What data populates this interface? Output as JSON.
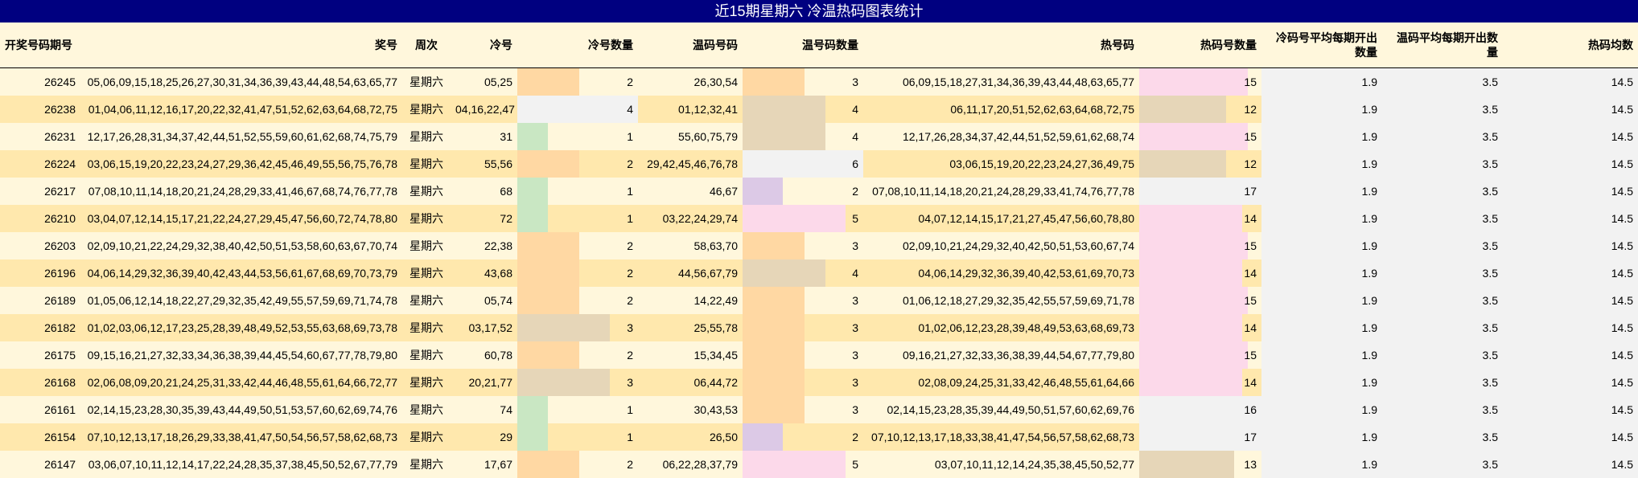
{
  "title": "近15期星期六 冷温热码图表统计",
  "headers": {
    "issue": "开奖号码期号",
    "numbers": "奖号",
    "weekday": "周次",
    "cold": "冷号",
    "cold_count": "冷号数量",
    "warm": "温码号码",
    "warm_count": "温号码数量",
    "hot": "热号码",
    "hot_count": "热码号数量",
    "cold_avg": "冷码号平均每期开出数量",
    "warm_avg": "温码平均每期开出数量",
    "hot_avg": "热码均数"
  },
  "colors": {
    "c1": "#c9e7c3",
    "c2": "#ffd8a3",
    "c3": "#e6d6b8",
    "c4": "#f2f2f2",
    "c5": "#fcd9ea",
    "c6": "#dcc9e6"
  },
  "rows": [
    {
      "issue": "26245",
      "numbers": "05,06,09,15,18,25,26,27,30,31,34,36,39,43,44,48,54,63,65,77",
      "weekday": "星期六",
      "cold": "05,25",
      "cold_count": 2,
      "warm": "26,30,54",
      "warm_count": 3,
      "hot": "06,09,15,18,27,31,34,36,39,43,44,48,63,65,77",
      "hot_count": 15,
      "cold_avg": "1.9",
      "warm_avg": "3.5",
      "hot_avg": "14.5"
    },
    {
      "issue": "26238",
      "numbers": "01,04,06,11,12,16,17,20,22,32,41,47,51,52,62,63,64,68,72,75",
      "weekday": "星期六",
      "cold": "04,16,22,47",
      "cold_count": 4,
      "warm": "01,12,32,41",
      "warm_count": 4,
      "hot": "06,11,17,20,51,52,62,63,64,68,72,75",
      "hot_count": 12,
      "cold_avg": "1.9",
      "warm_avg": "3.5",
      "hot_avg": "14.5"
    },
    {
      "issue": "26231",
      "numbers": "12,17,26,28,31,34,37,42,44,51,52,55,59,60,61,62,68,74,75,79",
      "weekday": "星期六",
      "cold": "31",
      "cold_count": 1,
      "warm": "55,60,75,79",
      "warm_count": 4,
      "hot": "12,17,26,28,34,37,42,44,51,52,59,61,62,68,74",
      "hot_count": 15,
      "cold_avg": "1.9",
      "warm_avg": "3.5",
      "hot_avg": "14.5"
    },
    {
      "issue": "26224",
      "numbers": "03,06,15,19,20,22,23,24,27,29,36,42,45,46,49,55,56,75,76,78",
      "weekday": "星期六",
      "cold": "55,56",
      "cold_count": 2,
      "warm": "29,42,45,46,76,78",
      "warm_count": 6,
      "hot": "03,06,15,19,20,22,23,24,27,36,49,75",
      "hot_count": 12,
      "cold_avg": "1.9",
      "warm_avg": "3.5",
      "hot_avg": "14.5"
    },
    {
      "issue": "26217",
      "numbers": "07,08,10,11,14,18,20,21,24,28,29,33,41,46,67,68,74,76,77,78",
      "weekday": "星期六",
      "cold": "68",
      "cold_count": 1,
      "warm": "46,67",
      "warm_count": 2,
      "hot": "07,08,10,11,14,18,20,21,24,28,29,33,41,74,76,77,78",
      "hot_count": 17,
      "cold_avg": "1.9",
      "warm_avg": "3.5",
      "hot_avg": "14.5"
    },
    {
      "issue": "26210",
      "numbers": "03,04,07,12,14,15,17,21,22,24,27,29,45,47,56,60,72,74,78,80",
      "weekday": "星期六",
      "cold": "72",
      "cold_count": 1,
      "warm": "03,22,24,29,74",
      "warm_count": 5,
      "hot": "04,07,12,14,15,17,21,27,45,47,56,60,78,80",
      "hot_count": 14,
      "cold_avg": "1.9",
      "warm_avg": "3.5",
      "hot_avg": "14.5"
    },
    {
      "issue": "26203",
      "numbers": "02,09,10,21,22,24,29,32,38,40,42,50,51,53,58,60,63,67,70,74",
      "weekday": "星期六",
      "cold": "22,38",
      "cold_count": 2,
      "warm": "58,63,70",
      "warm_count": 3,
      "hot": "02,09,10,21,24,29,32,40,42,50,51,53,60,67,74",
      "hot_count": 15,
      "cold_avg": "1.9",
      "warm_avg": "3.5",
      "hot_avg": "14.5"
    },
    {
      "issue": "26196",
      "numbers": "04,06,14,29,32,36,39,40,42,43,44,53,56,61,67,68,69,70,73,79",
      "weekday": "星期六",
      "cold": "43,68",
      "cold_count": 2,
      "warm": "44,56,67,79",
      "warm_count": 4,
      "hot": "04,06,14,29,32,36,39,40,42,53,61,69,70,73",
      "hot_count": 14,
      "cold_avg": "1.9",
      "warm_avg": "3.5",
      "hot_avg": "14.5"
    },
    {
      "issue": "26189",
      "numbers": "01,05,06,12,14,18,22,27,29,32,35,42,49,55,57,59,69,71,74,78",
      "weekday": "星期六",
      "cold": "05,74",
      "cold_count": 2,
      "warm": "14,22,49",
      "warm_count": 3,
      "hot": "01,06,12,18,27,29,32,35,42,55,57,59,69,71,78",
      "hot_count": 15,
      "cold_avg": "1.9",
      "warm_avg": "3.5",
      "hot_avg": "14.5"
    },
    {
      "issue": "26182",
      "numbers": "01,02,03,06,12,17,23,25,28,39,48,49,52,53,55,63,68,69,73,78",
      "weekday": "星期六",
      "cold": "03,17,52",
      "cold_count": 3,
      "warm": "25,55,78",
      "warm_count": 3,
      "hot": "01,02,06,12,23,28,39,48,49,53,63,68,69,73",
      "hot_count": 14,
      "cold_avg": "1.9",
      "warm_avg": "3.5",
      "hot_avg": "14.5"
    },
    {
      "issue": "26175",
      "numbers": "09,15,16,21,27,32,33,34,36,38,39,44,45,54,60,67,77,78,79,80",
      "weekday": "星期六",
      "cold": "60,78",
      "cold_count": 2,
      "warm": "15,34,45",
      "warm_count": 3,
      "hot": "09,16,21,27,32,33,36,38,39,44,54,67,77,79,80",
      "hot_count": 15,
      "cold_avg": "1.9",
      "warm_avg": "3.5",
      "hot_avg": "14.5"
    },
    {
      "issue": "26168",
      "numbers": "02,06,08,09,20,21,24,25,31,33,42,44,46,48,55,61,64,66,72,77",
      "weekday": "星期六",
      "cold": "20,21,77",
      "cold_count": 3,
      "warm": "06,44,72",
      "warm_count": 3,
      "hot": "02,08,09,24,25,31,33,42,46,48,55,61,64,66",
      "hot_count": 14,
      "cold_avg": "1.9",
      "warm_avg": "3.5",
      "hot_avg": "14.5"
    },
    {
      "issue": "26161",
      "numbers": "02,14,15,23,28,30,35,39,43,44,49,50,51,53,57,60,62,69,74,76",
      "weekday": "星期六",
      "cold": "74",
      "cold_count": 1,
      "warm": "30,43,53",
      "warm_count": 3,
      "hot": "02,14,15,23,28,35,39,44,49,50,51,57,60,62,69,76",
      "hot_count": 16,
      "cold_avg": "1.9",
      "warm_avg": "3.5",
      "hot_avg": "14.5"
    },
    {
      "issue": "26154",
      "numbers": "07,10,12,13,17,18,26,29,33,38,41,47,50,54,56,57,58,62,68,73",
      "weekday": "星期六",
      "cold": "29",
      "cold_count": 1,
      "warm": "26,50",
      "warm_count": 2,
      "hot": "07,10,12,13,17,18,33,38,41,47,54,56,57,58,62,68,73",
      "hot_count": 17,
      "cold_avg": "1.9",
      "warm_avg": "3.5",
      "hot_avg": "14.5"
    },
    {
      "issue": "26147",
      "numbers": "03,06,07,10,11,12,14,17,22,24,28,35,37,38,45,50,52,67,77,79",
      "weekday": "星期六",
      "cold": "17,67",
      "cold_count": 2,
      "warm": "06,22,28,37,79",
      "warm_count": 5,
      "hot": "03,07,10,11,12,14,24,35,38,45,50,52,77",
      "hot_count": 13,
      "cold_avg": "1.9",
      "warm_avg": "3.5",
      "hot_avg": "14.5"
    }
  ]
}
